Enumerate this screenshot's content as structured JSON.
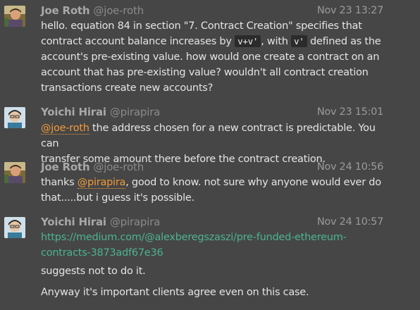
{
  "messages": [
    {
      "author": "Joe Roth",
      "handle": "@joe-roth",
      "time": "Nov 23 13:27",
      "text_lines": [
        "hello. equation 84 in section \"7. Contract Creation\" specifies that",
        "account's pre-existing value. how would one create a contract on an",
        "account that has pre-existing value? wouldn't all contract creation",
        "transactions create new accounts?"
      ],
      "line2_prefix": "contract account balance increases by ",
      "line2_code1": "v+v'",
      "line2_mid": ", with ",
      "line2_code2": "v'",
      "line2_suffix": " defined as the"
    },
    {
      "author": "Yoichi Hirai",
      "handle": "@pirapira",
      "time": "Nov 23 15:01",
      "mention": "@joe-roth",
      "line1_rest": " the address chosen for a new contract is predictable. You can",
      "line2": "transfer some amount there before the contract creation."
    },
    {
      "author": "Joe Roth",
      "handle": "@joe-roth",
      "time": "Nov 24 10:56",
      "prefix": "thanks ",
      "mention": "@pirapira",
      "line1_rest": ", good to know. not sure why anyone would ever do",
      "line2": "that.....but i guess it's possible."
    },
    {
      "author": "Yoichi Hirai",
      "handle": "@pirapira",
      "time": "Nov 24 10:57",
      "link_line1": "https://medium.com/@alexberegszaszi/pre-funded-ethereum-",
      "link_line2": "contracts-3873adf67e36",
      "followup1": "suggests not to do it.",
      "followup2": "Anyway it's important clients agree even on this case."
    }
  ],
  "colors": {
    "background": "#464646",
    "mention": "#f19a3a",
    "link": "#4cb390",
    "code_bg": "#2b2b2b"
  }
}
